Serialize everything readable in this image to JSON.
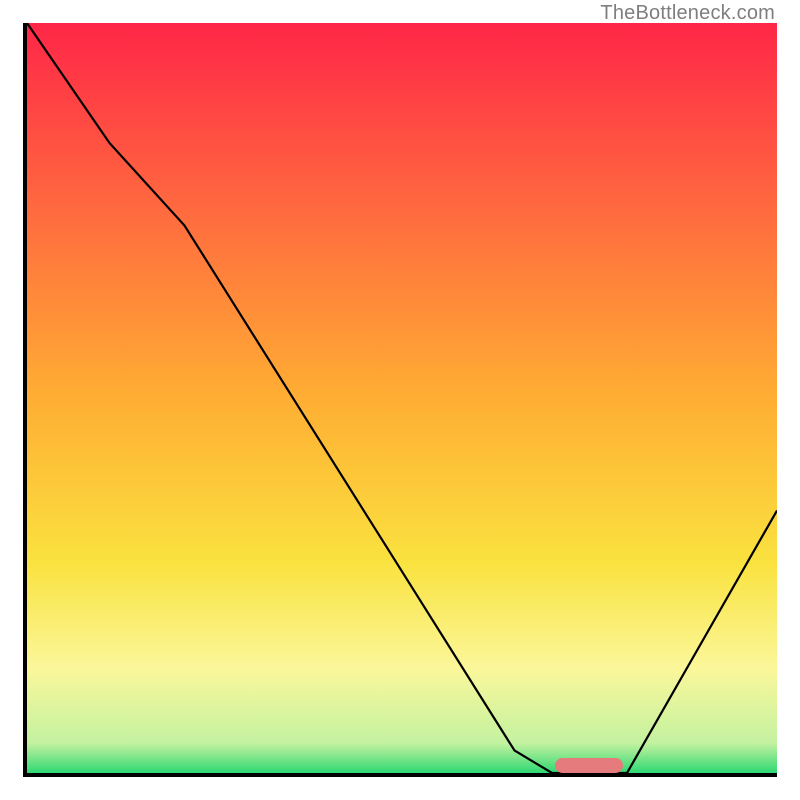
{
  "watermark": "TheBottleneck.com",
  "colors": {
    "gradient_stops": [
      {
        "offset": 0.0,
        "color": "#ff2647"
      },
      {
        "offset": 0.25,
        "color": "#ff6a3f"
      },
      {
        "offset": 0.5,
        "color": "#ffae33"
      },
      {
        "offset": 0.72,
        "color": "#fae23f"
      },
      {
        "offset": 0.86,
        "color": "#fbf79a"
      },
      {
        "offset": 0.96,
        "color": "#c4f2a0"
      },
      {
        "offset": 1.0,
        "color": "#2fd873"
      }
    ],
    "curve": "#000000",
    "marker": "#e67b7d"
  },
  "chart_data": {
    "type": "line",
    "title": "",
    "xlabel": "",
    "ylabel": "",
    "xlim": [
      0,
      100
    ],
    "ylim": [
      0,
      100
    ],
    "x": [
      0,
      11,
      21,
      65,
      70,
      80,
      100
    ],
    "values": [
      100,
      84,
      73,
      3,
      0,
      0,
      35
    ],
    "marker": {
      "x_start": 70,
      "x_end": 79,
      "y": 0
    }
  }
}
